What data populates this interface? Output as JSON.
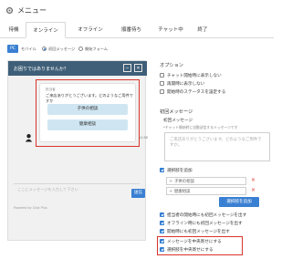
{
  "header": {
    "title": "メニュー",
    "icon": "gear-icon"
  },
  "tabs": [
    {
      "label": "待機"
    },
    {
      "label": "オンライン",
      "active": true
    },
    {
      "label": "オフライン"
    },
    {
      "label": "順番待ち"
    },
    {
      "label": "チャット中"
    },
    {
      "label": "終了"
    }
  ],
  "view": {
    "pc_label": "PC",
    "mobile_label": "モバイル",
    "radio_first": "初回メッセージ",
    "radio_open": "開始フォーム"
  },
  "preview": {
    "title": "お困りではありませんか？",
    "minimize": "−",
    "close": "✕",
    "sender": "担当者",
    "message": "ご来店ありがとうございます。どのようなご用件ですか",
    "choices": [
      "子供の相談",
      "健康相談"
    ],
    "time": "11:58",
    "input_placeholder": "ここにメッセージを入力して下さい",
    "send_label": "送信",
    "powered": "Powered by Chat Plus",
    "accent": "#d9342b"
  },
  "options": {
    "title": "オプション",
    "items": [
      {
        "label": "チャット開始時に表示しない",
        "checked": false
      },
      {
        "label": "再開時に表示しない",
        "checked": false
      },
      {
        "label": "開始時のステータスを設定する",
        "checked": false
      }
    ]
  },
  "first_message": {
    "section_label": "初回メッセージ",
    "field_label": "初回メッセージ",
    "hint": "*チャット開始時に自動送信するメッセージです",
    "placeholder": "ご来店ありがとうございます。どのようなご用件ですか。"
  },
  "choices_setting": {
    "label": "選択肢を追加",
    "options": [
      "子供の相談",
      "健康相談"
    ],
    "add_button": "選択肢を追加"
  },
  "bottom_options": [
    {
      "label": "担当者の開始時にも初回メッセージを出す",
      "checked": true
    },
    {
      "label": "オフライン時にも初回メッセージを出す",
      "checked": true
    },
    {
      "label": "開始時にも初回メッセージを出す",
      "checked": true
    },
    {
      "label": "メッセージを中央寄せにする",
      "checked": true
    },
    {
      "label": "選択肢を中央寄せにする",
      "checked": true
    }
  ],
  "colors": {
    "primary": "#3a80d2",
    "header": "#3f5f78",
    "choice": "#cfe6f2",
    "highlight": "#d9342b"
  }
}
